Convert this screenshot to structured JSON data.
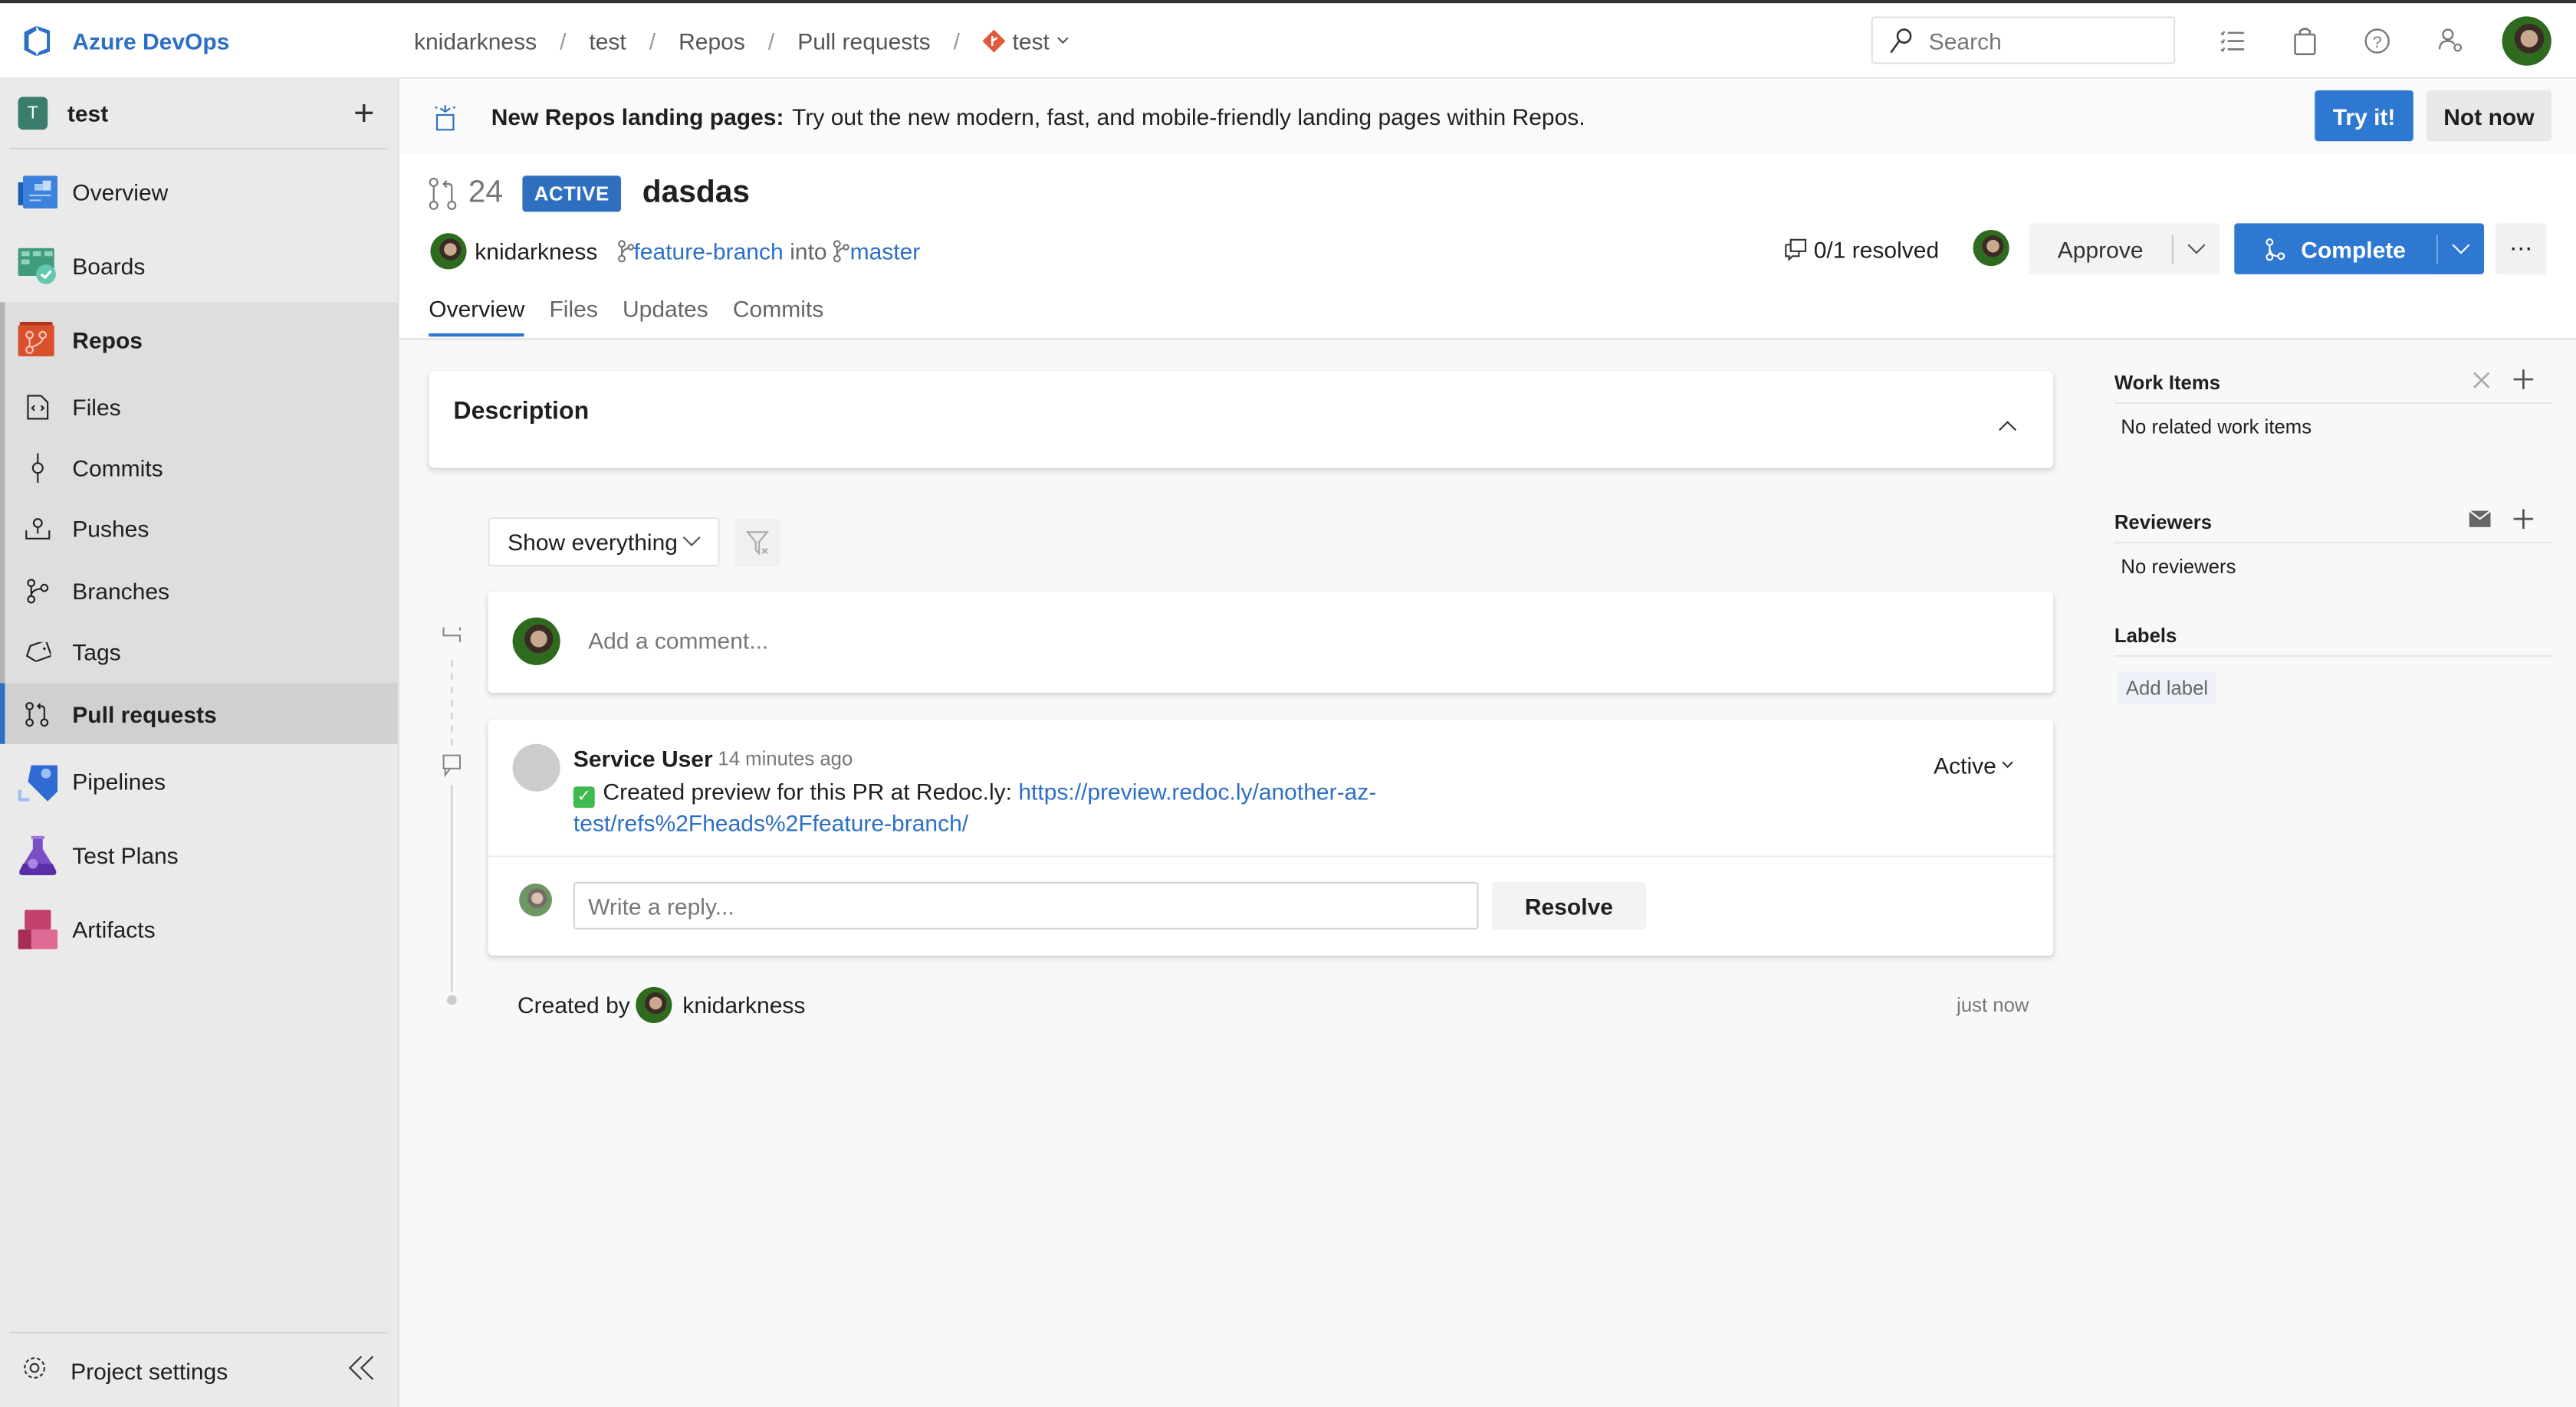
{
  "app": {
    "name": "Azure DevOps",
    "accent": "#2f78d1"
  },
  "breadcrumb": [
    {
      "label": "knidarkness"
    },
    {
      "label": "test"
    },
    {
      "label": "Repos"
    },
    {
      "label": "Pull requests"
    },
    {
      "label": "test"
    }
  ],
  "search": {
    "placeholder": "Search"
  },
  "header_icons": [
    "task-list-icon",
    "shopping-bag-icon",
    "help-icon",
    "user-settings-icon",
    "user-avatar"
  ],
  "sidebar": {
    "project_initial": "T",
    "project_name": "test",
    "items": [
      {
        "label": "Overview",
        "icon": "overview-icon"
      },
      {
        "label": "Boards",
        "icon": "boards-icon"
      },
      {
        "label": "Repos",
        "icon": "repos-icon"
      },
      {
        "label": "Files",
        "icon": "files-icon"
      },
      {
        "label": "Commits",
        "icon": "commits-icon"
      },
      {
        "label": "Pushes",
        "icon": "pushes-icon"
      },
      {
        "label": "Branches",
        "icon": "branches-icon"
      },
      {
        "label": "Tags",
        "icon": "tags-icon"
      },
      {
        "label": "Pull requests",
        "icon": "pull-request-icon",
        "selected": true
      },
      {
        "label": "Pipelines",
        "icon": "pipelines-icon"
      },
      {
        "label": "Test Plans",
        "icon": "test-plans-icon"
      },
      {
        "label": "Artifacts",
        "icon": "artifacts-icon"
      }
    ],
    "footer": {
      "label": "Project settings"
    }
  },
  "banner": {
    "title": "New Repos landing pages:",
    "text": "Try out the new modern, fast, and mobile-friendly landing pages within Repos.",
    "primary": "Try it!",
    "secondary": "Not now"
  },
  "pr": {
    "id": "24",
    "status": "ACTIVE",
    "title": "dasdas",
    "author": "knidarkness",
    "source_branch": "feature-branch",
    "into": "into",
    "target_branch": "master",
    "resolved": "0/1 resolved",
    "approve": "Approve",
    "complete": "Complete",
    "more": "⋯",
    "tabs": [
      "Overview",
      "Files",
      "Updates",
      "Commits"
    ],
    "active_tab": "Overview"
  },
  "description": {
    "title": "Description"
  },
  "filter": {
    "value": "Show everything"
  },
  "add_comment": {
    "placeholder": "Add a comment..."
  },
  "thread": {
    "author": "Service User",
    "time": "14 minutes ago",
    "text": "Created preview for this PR at Redoc.ly:",
    "link": "https://preview.redoc.ly/another-az-test/refs%2Fheads%2Ffeature-branch/",
    "status": "Active",
    "reply_placeholder": "Write a reply...",
    "resolve": "Resolve"
  },
  "created": {
    "prefix": "Created by",
    "author": "knidarkness",
    "time": "just now"
  },
  "right_panel": {
    "work_items": {
      "title": "Work Items",
      "empty": "No related work items"
    },
    "reviewers": {
      "title": "Reviewers",
      "empty": "No reviewers"
    },
    "labels": {
      "title": "Labels",
      "add": "Add label"
    }
  }
}
